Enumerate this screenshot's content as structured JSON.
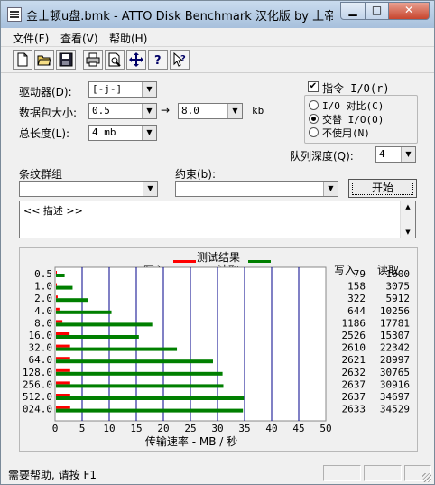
{
  "window": {
    "title": "金士顿u盘.bmk - ATTO Disk Benchmark 汉化版 by 上帝之..."
  },
  "menu": [
    {
      "label": "文件(F)"
    },
    {
      "label": "查看(V)"
    },
    {
      "label": "帮助(H)"
    }
  ],
  "toolbar": {
    "icons": [
      "new-file-icon",
      "open-folder-icon",
      "save-icon",
      "print-icon",
      "print-preview-icon",
      "move-icon",
      "help-icon",
      "context-help-icon"
    ]
  },
  "settings": {
    "drive_label": "驱动器(D):",
    "drive_value": "[-j-]",
    "packet_label": "数据包大小:",
    "packet_from": "0.5",
    "packet_arrow": "→",
    "packet_to": "8.0",
    "packet_unit": "kb",
    "length_label": "总长度(L):",
    "length_value": "4 mb",
    "stripe_label": "条纹群组",
    "stripe_value": "",
    "constraint_label": "约束(b):",
    "constraint_value": "",
    "io_check_label": "指令 I/O(r)",
    "io_check_checked": true,
    "radio1_label": "I/O 对比(C)",
    "radio2_label": "交替 I/O(O)",
    "radio3_label": "不使用(N)",
    "radio_selected": 2,
    "queue_label": "队列深度(Q):",
    "queue_value": "4",
    "start_button": "开始"
  },
  "description": {
    "text": "<< 描述 >>"
  },
  "results": {
    "title": "测试结果",
    "write_legend": "写入",
    "read_legend": "读取",
    "write_col": "写入",
    "read_col": "读取",
    "xlabel": "传输速率 - MB / 秒"
  },
  "chart_data": {
    "type": "bar",
    "orientation": "horizontal",
    "title": "测试结果",
    "xlabel": "传输速率 - MB / 秒",
    "xlim": [
      0,
      50
    ],
    "xticks": [
      "0",
      "5",
      "10",
      "15",
      "20",
      "25",
      "30",
      "35",
      "40",
      "45",
      "50"
    ],
    "categories": [
      "0.5",
      "1.0",
      "2.0",
      "4.0",
      "8.0",
      "16.0",
      "32.0",
      "64.0",
      "128.0",
      "256.0",
      "512.0",
      "024.0"
    ],
    "series": [
      {
        "name": "写入",
        "color": "#ff0000",
        "values": [
          0.079,
          0.158,
          0.322,
          0.644,
          1.186,
          2.526,
          2.61,
          2.621,
          2.632,
          2.637,
          2.637,
          2.633
        ],
        "labels": [
          "79",
          "158",
          "322",
          "644",
          "1186",
          "2526",
          "2610",
          "2621",
          "2632",
          "2637",
          "2637",
          "2633"
        ]
      },
      {
        "name": "读取",
        "color": "#007f00",
        "values": [
          1.6,
          3.075,
          5.912,
          10.256,
          17.781,
          15.307,
          22.342,
          28.997,
          30.765,
          30.916,
          34.697,
          34.529
        ],
        "labels": [
          "1600",
          "3075",
          "5912",
          "10256",
          "17781",
          "15307",
          "22342",
          "28997",
          "30765",
          "30916",
          "34697",
          "34529"
        ]
      }
    ]
  },
  "statusbar": {
    "text": "需要帮助, 请按 F1"
  },
  "colors": {
    "write": "#ff0000",
    "read": "#007f00",
    "gridline": "#00008b"
  }
}
